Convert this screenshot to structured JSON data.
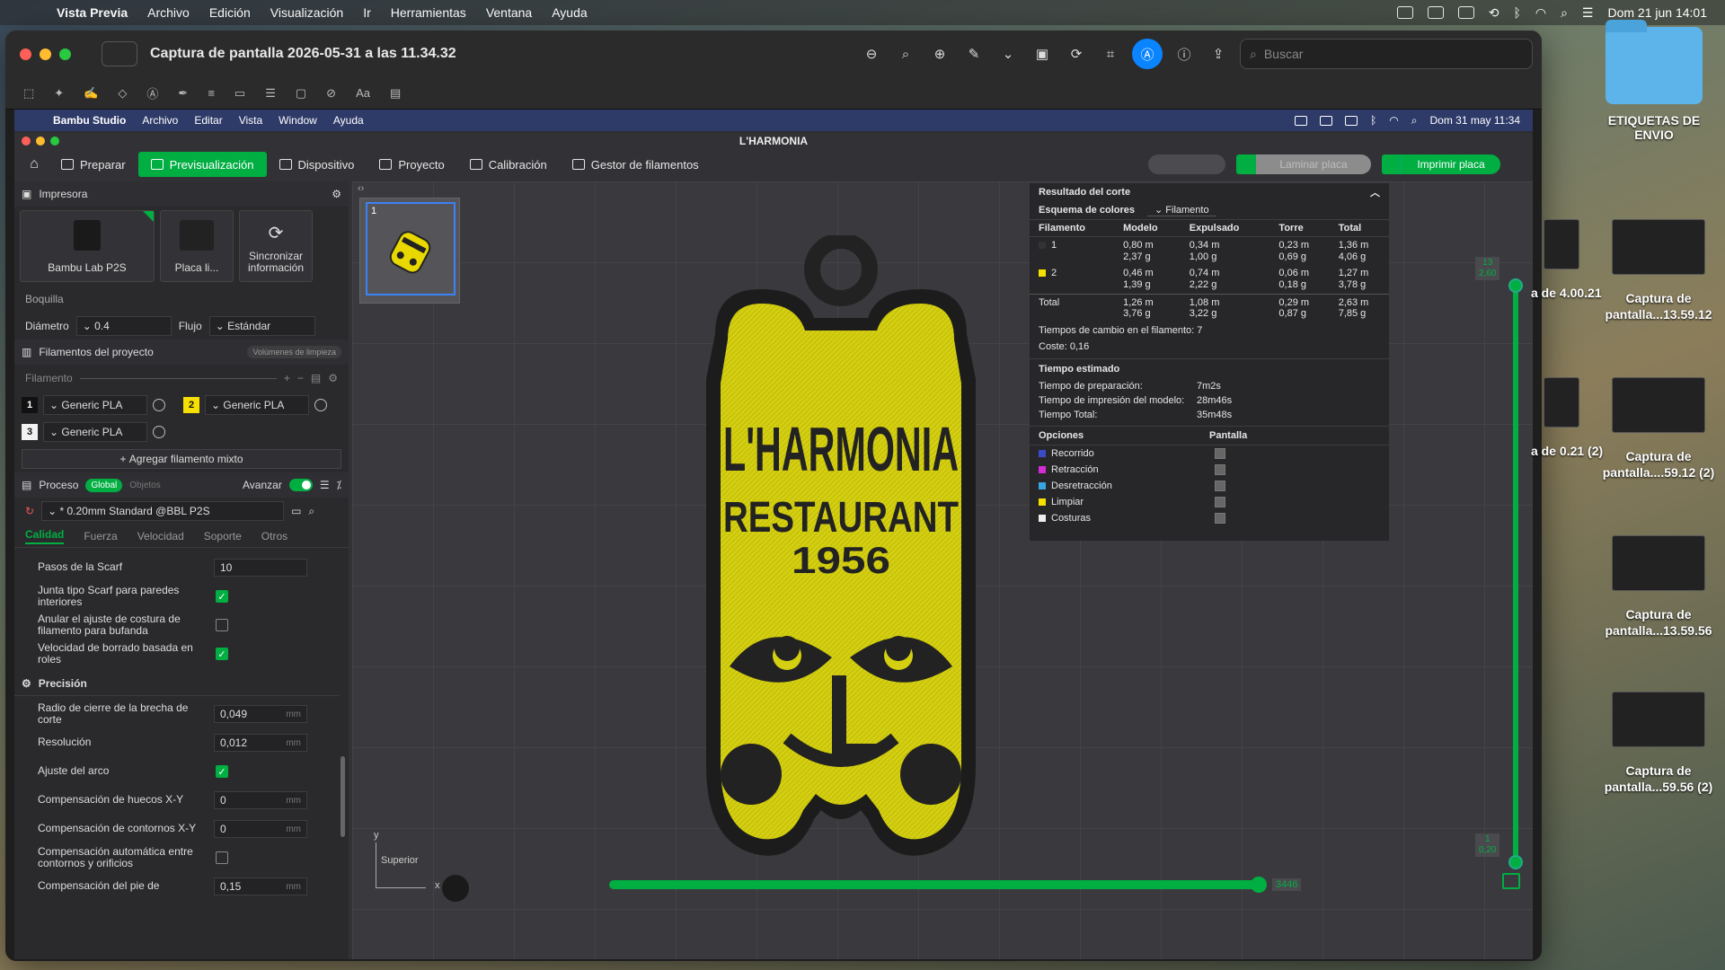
{
  "os_menubar": {
    "app": "Vista Previa",
    "menus": [
      "Archivo",
      "Edición",
      "Visualización",
      "Ir",
      "Herramientas",
      "Ventana",
      "Ayuda"
    ],
    "datetime": "Dom 21 jun 14:01"
  },
  "preview": {
    "title": "Captura de pantalla 2026-05-31 a las 11.34.32",
    "search_placeholder": "Buscar"
  },
  "inner_menubar": {
    "app": "Bambu Studio",
    "menus": [
      "Archivo",
      "Editar",
      "Vista",
      "Window",
      "Ayuda"
    ],
    "datetime": "Dom 31 may 11:34"
  },
  "bambu": {
    "window_title": "L'HARMONIA",
    "tabs": [
      "Preparar",
      "Previsualización",
      "Dispositivo",
      "Proyecto",
      "Calibración",
      "Gestor de filamentos"
    ],
    "slice_label": "Laminar placa",
    "print_label": "Imprimir placa",
    "printer": {
      "header": "Impresora",
      "printer_name": "Bambu Lab P2S",
      "plate_name": "Placa li...",
      "sync_label": "Sincronizar información",
      "nozzle_label": "Boquilla",
      "diameter_label": "Diámetro",
      "diameter_value": "0.4",
      "flow_label": "Flujo",
      "flow_value": "Estándar"
    },
    "filaments": {
      "header": "Filamentos del proyecto",
      "purge_label": "Volúmenes de limpieza",
      "filament_label": "Filamento",
      "items": [
        {
          "num": "1",
          "name": "Generic PLA",
          "color": "#111111",
          "text_color": "#ffffff"
        },
        {
          "num": "2",
          "name": "Generic PLA",
          "color": "#f5e000",
          "text_color": "#111111"
        },
        {
          "num": "3",
          "name": "Generic PLA",
          "color": "#f2f2f2",
          "text_color": "#111111"
        }
      ],
      "add_mix_label": "Agregar filamento mixto"
    },
    "process": {
      "header": "Proceso",
      "global_label": "Global",
      "objects_label": "Objetos",
      "advance_label": "Avanzar",
      "preset": "* 0.20mm Standard @BBL P2S",
      "tabs": [
        "Calidad",
        "Fuerza",
        "Velocidad",
        "Soporte",
        "Otros"
      ],
      "options": [
        {
          "label": "Pasos de la Scarf",
          "type": "number",
          "value": "10",
          "unit": ""
        },
        {
          "label": "Junta tipo Scarf para paredes interiores",
          "type": "check",
          "checked": true
        },
        {
          "label": "Anular el ajuste de costura de filamento para bufanda",
          "type": "check",
          "checked": false
        },
        {
          "label": "Velocidad de borrado basada en roles",
          "type": "check",
          "checked": true
        }
      ],
      "precision_header": "Precisión",
      "precision": [
        {
          "label": "Radio de cierre de la brecha de corte",
          "type": "number",
          "value": "0,049",
          "unit": "mm"
        },
        {
          "label": "Resolución",
          "type": "number",
          "value": "0,012",
          "unit": "mm"
        },
        {
          "label": "Ajuste del arco",
          "type": "check",
          "checked": true
        },
        {
          "label": "Compensación de huecos X-Y",
          "type": "number",
          "value": "0",
          "unit": "mm"
        },
        {
          "label": "Compensación de contornos X-Y",
          "type": "number",
          "value": "0",
          "unit": "mm"
        },
        {
          "label": "Compensación automática entre contornos y orificios",
          "type": "check",
          "checked": false
        },
        {
          "label": "Compensación del pie de",
          "type": "number",
          "value": "0,15",
          "unit": "mm"
        }
      ]
    },
    "viewport": {
      "plate_number": "1",
      "axis_view_label": "Superior",
      "axis_x": "x",
      "axis_y": "y",
      "layer_top": "13",
      "layer_top_height": "2,60",
      "layer_bottom": "1",
      "layer_bottom_height": "0,20",
      "h_value": "3446",
      "model_text": {
        "line1": "L'HARMONIA",
        "line2": "RESTAURANT",
        "line3": "1956"
      }
    },
    "results": {
      "title": "Resultado del corte",
      "scheme_label": "Esquema de colores",
      "scheme_value": "Filamento",
      "columns": [
        "Filamento",
        "Modelo",
        "Expulsado",
        "Torre",
        "Total"
      ],
      "rows": [
        {
          "id": "1",
          "color": "#333333",
          "model": [
            "0,80 m",
            "2,37 g"
          ],
          "flushed": [
            "0,34 m",
            "1,00 g"
          ],
          "tower": [
            "0,23 m",
            "0,69 g"
          ],
          "total": [
            "1,36 m",
            "4,06 g"
          ]
        },
        {
          "id": "2",
          "color": "#f5e000",
          "model": [
            "0,46 m",
            "1,39 g"
          ],
          "flushed": [
            "0,74 m",
            "2,22 g"
          ],
          "tower": [
            "0,06 m",
            "0,18 g"
          ],
          "total": [
            "1,27 m",
            "3,78 g"
          ]
        }
      ],
      "total_row": {
        "label": "Total",
        "model": [
          "1,26 m",
          "3,76 g"
        ],
        "flushed": [
          "1,08 m",
          "3,22 g"
        ],
        "tower": [
          "0,29 m",
          "0,87 g"
        ],
        "total": [
          "2,63 m",
          "7,85 g"
        ]
      },
      "change_times": "Tiempos de cambio en el filamento:  7",
      "cost": "Coste:  0,16",
      "time_header": "Tiempo estimado",
      "times": [
        {
          "k": "Tiempo de preparación:",
          "v": "7m2s"
        },
        {
          "k": "Tiempo de impresión del modelo:",
          "v": "28m46s"
        },
        {
          "k": "Tiempo Total:",
          "v": "35m48s"
        }
      ],
      "options_header": "Opciones",
      "display_header": "Pantalla",
      "options": [
        {
          "label": "Recorrido",
          "color": "#3b4bc8"
        },
        {
          "label": "Retracción",
          "color": "#d52bd5"
        },
        {
          "label": "Desretracción",
          "color": "#37a6e0"
        },
        {
          "label": "Limpiar",
          "color": "#f5e000"
        },
        {
          "label": "Costuras",
          "color": "#eeeeee"
        }
      ]
    }
  },
  "desktop": {
    "folder_label": "ETIQUETAS DE ENVIO",
    "items": [
      {
        "label": "Captura de pantalla...13.59.12"
      },
      {
        "label": "Captura de pantalla....59.12 (2)"
      },
      {
        "label": "Captura de pantalla...13.59.56"
      },
      {
        "label": "Captura de pantalla...59.56 (2)"
      }
    ],
    "cut_items": [
      {
        "label": "a de 4.00.21"
      },
      {
        "label": "a de 0.21 (2)"
      }
    ]
  }
}
